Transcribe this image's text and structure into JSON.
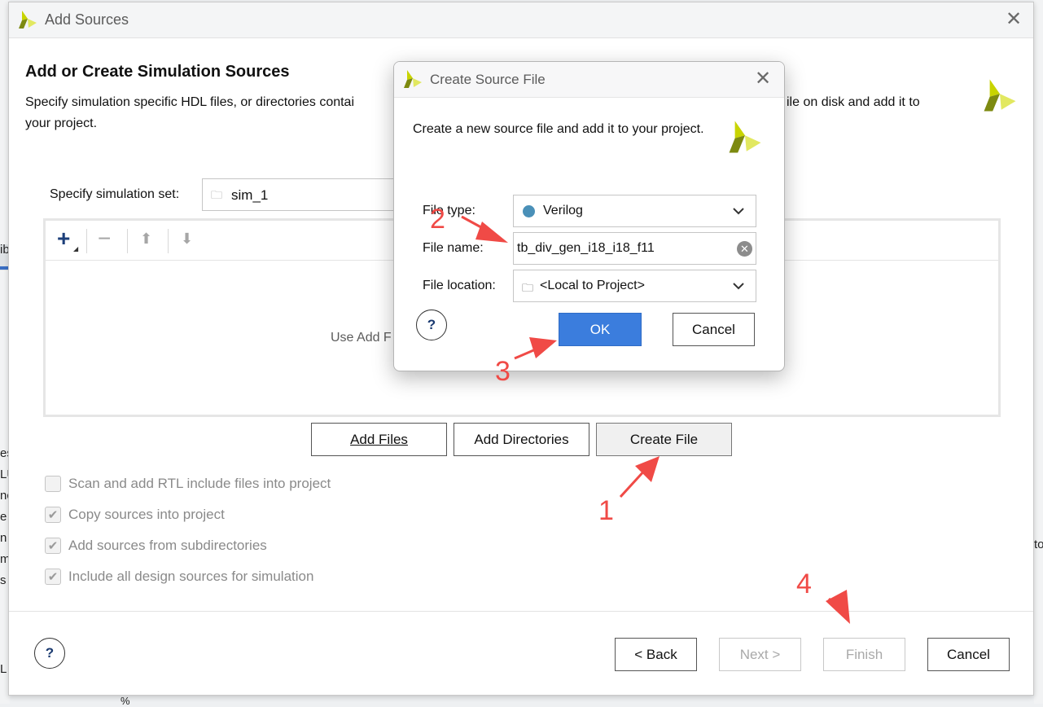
{
  "background_fragments": [
    "ib",
    "es",
    "LU",
    "nc",
    "e",
    "n",
    "m",
    "s",
    "to",
    "L",
    "%"
  ],
  "main_dialog": {
    "title": "Add Sources",
    "heading": "Add or Create Simulation Sources",
    "description_line1_left": "Specify simulation specific HDL files, or directories contai",
    "description_line1_right": "ile on disk and add it to",
    "description_line2": "your project.",
    "simset_label": "Specify simulation set:",
    "simset_value": "sim_1",
    "list_hint": "Use Add F",
    "buttons": {
      "add_files": "Add Files",
      "add_directories": "Add Directories",
      "create_file": "Create File",
      "back": "< Back",
      "next": "Next >",
      "finish": "Finish",
      "cancel": "Cancel",
      "help": "?"
    },
    "checkboxes": [
      {
        "label": "Scan and add RTL include files into project",
        "checked": false
      },
      {
        "label": "Copy sources into project",
        "checked": true
      },
      {
        "label": "Add sources from subdirectories",
        "checked": true
      },
      {
        "label": "Include all design sources for simulation",
        "checked": true
      }
    ]
  },
  "create_dialog": {
    "title": "Create Source File",
    "description": "Create a new source file and add it to your project.",
    "file_type_label": "File type:",
    "file_type_value": "Verilog",
    "file_name_label": "File name:",
    "file_name_value": "tb_div_gen_i18_i18_f11",
    "file_location_label": "File location:",
    "file_location_value": "<Local to Project>",
    "ok": "OK",
    "cancel": "Cancel",
    "help": "?"
  },
  "annotations": [
    "1",
    "2",
    "3",
    "4"
  ],
  "colors": {
    "annotation": "#f04a46",
    "ok_button": "#3b7ddd",
    "verilog_dot": "#4a90b8"
  }
}
